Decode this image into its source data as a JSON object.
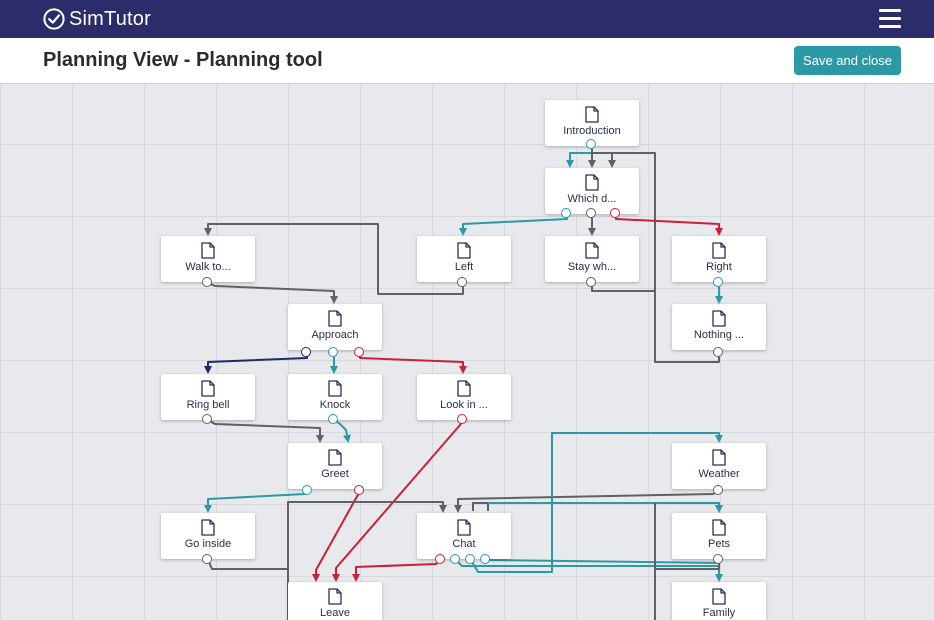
{
  "app": {
    "brand": "SimTutor",
    "menu_icon": "hamburger-menu-icon"
  },
  "header": {
    "title": "Planning View - Planning tool",
    "save_label": "Save and close"
  },
  "colors": {
    "topbar": "#2c2c6b",
    "accent": "#2b9aa6",
    "link_gray": "#606166",
    "link_teal": "#2b9aa6",
    "link_red": "#cc1f3a",
    "link_navy": "#1f2a6e"
  },
  "nodes": [
    {
      "id": "introduction",
      "label": "Introduction"
    },
    {
      "id": "which",
      "label": "Which d..."
    },
    {
      "id": "walk",
      "label": "Walk to..."
    },
    {
      "id": "left",
      "label": "Left"
    },
    {
      "id": "stay",
      "label": "Stay wh..."
    },
    {
      "id": "right",
      "label": "Right"
    },
    {
      "id": "approach",
      "label": "Approach"
    },
    {
      "id": "nothing",
      "label": "Nothing ..."
    },
    {
      "id": "ringbell",
      "label": "Ring bell"
    },
    {
      "id": "knock",
      "label": "Knock"
    },
    {
      "id": "lookin",
      "label": "Look in ..."
    },
    {
      "id": "greet",
      "label": "Greet"
    },
    {
      "id": "weather",
      "label": "Weather"
    },
    {
      "id": "goinside",
      "label": "Go inside"
    },
    {
      "id": "chat",
      "label": "Chat"
    },
    {
      "id": "pets",
      "label": "Pets"
    },
    {
      "id": "leave",
      "label": "Leave"
    },
    {
      "id": "family",
      "label": "Family"
    }
  ]
}
